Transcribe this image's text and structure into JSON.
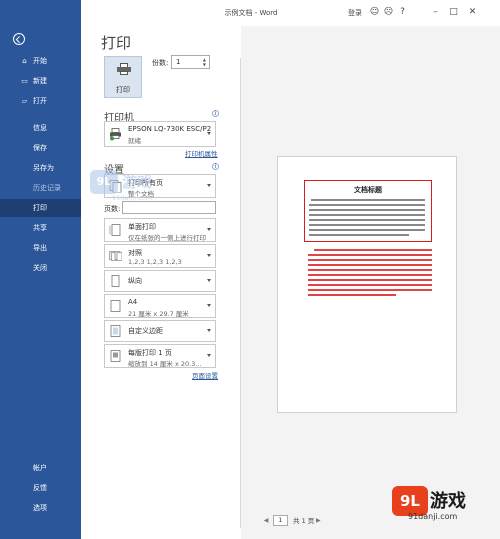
{
  "window": {
    "title": "示例文档 - Word",
    "login": "登录",
    "icons": [
      "smiley-icon",
      "frown-icon",
      "help-icon",
      "minimize-icon",
      "restore-icon",
      "close-icon"
    ]
  },
  "sidebar": {
    "items": [
      {
        "label": "开始",
        "icon": "home-icon"
      },
      {
        "label": "新建",
        "icon": "new-icon"
      },
      {
        "label": "打开",
        "icon": "open-icon"
      },
      {
        "label": "信息"
      },
      {
        "label": "保存"
      },
      {
        "label": "另存为"
      },
      {
        "label": "历史记录"
      },
      {
        "label": "打印"
      },
      {
        "label": "共享"
      },
      {
        "label": "导出"
      },
      {
        "label": "关闭"
      }
    ],
    "bottom_items": [
      {
        "label": "帐户"
      },
      {
        "label": "反馈"
      },
      {
        "label": "选项"
      }
    ],
    "active": "打印",
    "colors": {
      "background": "#2b579a",
      "active": "#1e3f74"
    }
  },
  "print": {
    "heading": "打印",
    "print_button": "打印",
    "copies_label": "份数:",
    "copies_value": "1"
  },
  "printer": {
    "section_title": "打印机",
    "name": "EPSON LQ-730K ESC/P2",
    "status": "就绪",
    "properties_link": "打印机属性"
  },
  "settings": {
    "section_title": "设置",
    "print_all_line1": "打印所有页",
    "print_all_line2": "整个文档",
    "pages_label": "页数:",
    "pages_value": "",
    "options": [
      {
        "line1": "单面打印",
        "line2": "仅在纸张的一侧上进行打印"
      },
      {
        "line1": "对照",
        "line2": "1,2,3    1,2,3    1,2,3"
      },
      {
        "line1": "纵向",
        "line2": ""
      },
      {
        "line1": "A4",
        "line2": "21 厘米 x 29.7 厘米"
      },
      {
        "line1": "自定义边距",
        "line2": ""
      },
      {
        "line1": "每版打印 1 页",
        "line2": "缩放到 14 厘米 x 20.3..."
      }
    ],
    "page_setup_link": "页面设置"
  },
  "preview": {
    "doc_title": "文档标题",
    "current_page": "1",
    "total_pages": "共 1 页",
    "accent": "#d81e1e"
  },
  "watermark": {
    "mark": "9L",
    "text": "游戏",
    "url": "91danji.com"
  }
}
